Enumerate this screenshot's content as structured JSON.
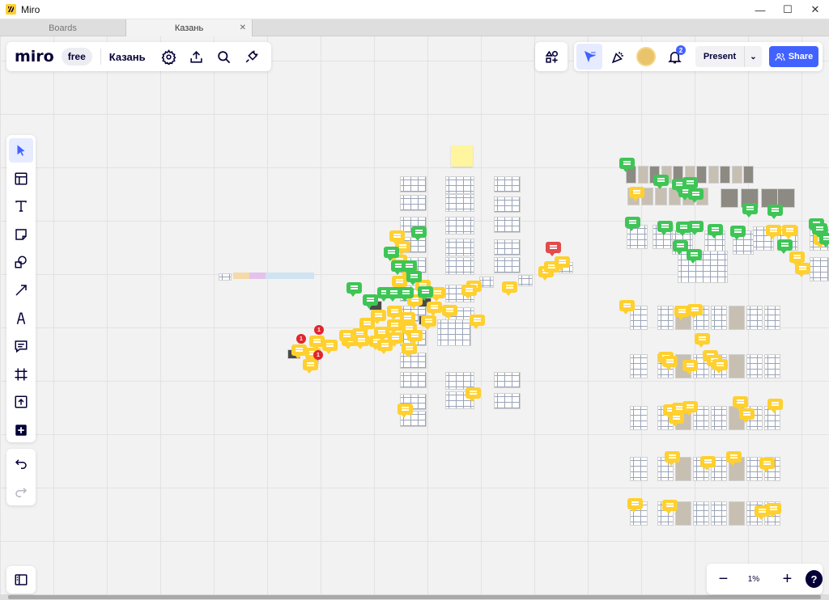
{
  "window": {
    "title": "Miro",
    "controls": {
      "minimize": "—",
      "maximize": "☐",
      "close": "✕"
    }
  },
  "tabs": [
    {
      "label": "Boards",
      "active": false
    },
    {
      "label": "Казань",
      "active": true,
      "close": "✕"
    }
  ],
  "board_bar": {
    "logo": "miro",
    "plan_badge": "free",
    "board_name": "Казань",
    "icons": [
      "settings-icon",
      "upload-icon",
      "search-icon",
      "plugin-icon"
    ]
  },
  "collab_bar": {
    "icons": [
      "apps-icon",
      "cursor-filter-icon",
      "celebrate-icon",
      "avatar",
      "bell-icon"
    ],
    "notification_count": "2",
    "present_label": "Present",
    "present_caret": "⌄",
    "share_label": "Share"
  },
  "tools": [
    "select-tool",
    "templates-tool",
    "text-tool",
    "sticky-note-tool",
    "shapes-tool",
    "connection-line-tool",
    "pen-tool",
    "comment-tool",
    "frame-tool",
    "upload-tool",
    "more-apps-tool"
  ],
  "history": [
    "undo",
    "redo"
  ],
  "zoom": {
    "minus": "−",
    "level": "1%",
    "plus": "+",
    "help": "?"
  },
  "comment_badges": [
    "1",
    "1",
    "1"
  ],
  "colors": {
    "accent": "#4262ff",
    "comment_yellow": "#ffd02f",
    "comment_green": "#3ec556",
    "comment_red": "#e24b4b",
    "canvas": "#f2f2f2"
  }
}
